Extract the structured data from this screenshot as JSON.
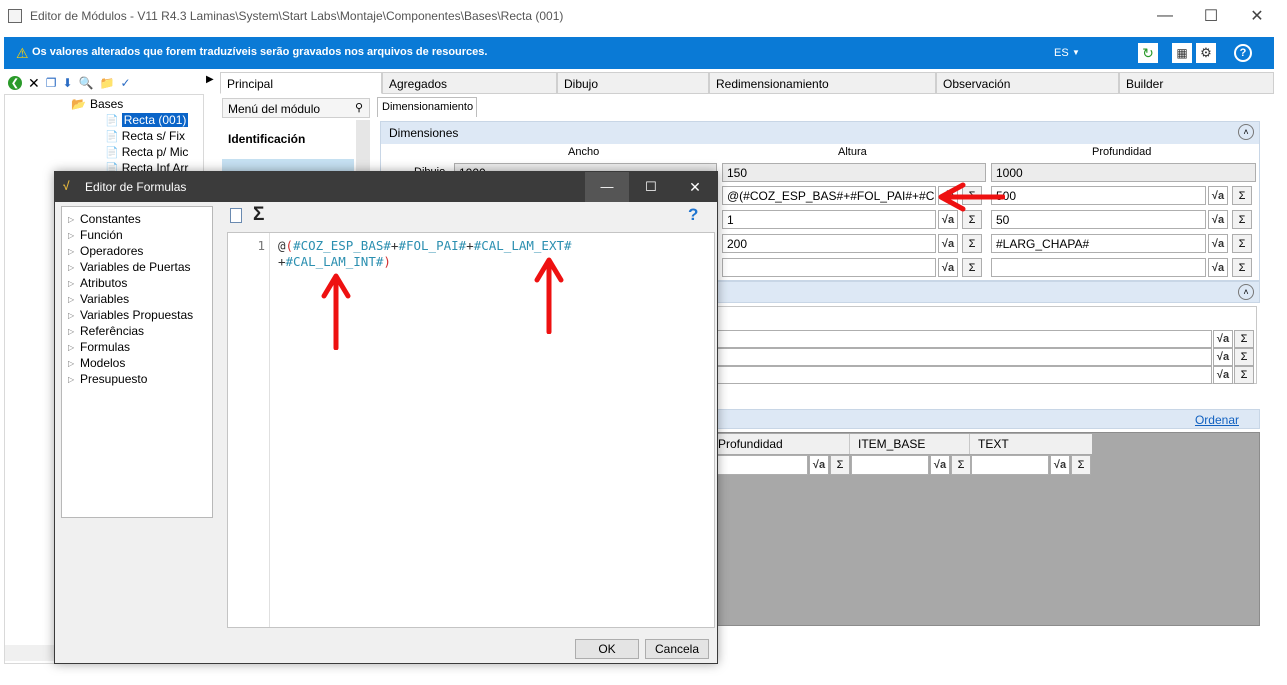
{
  "window": {
    "title": "Editor de Módulos - V11 R4.3 Laminas\\System\\Start Labs\\Montaje\\Componentes\\Bases\\Recta (001)"
  },
  "banner": {
    "message": "Os valores alterados que forem traduzíveis serão gravados nos arquivos de resources.",
    "lang": "ES",
    "color": "#0a7ad6"
  },
  "tree": {
    "folder": "Bases",
    "items": [
      "Recta (001)",
      "Recta s/ Fix",
      "Recta p/ Mic",
      "Recta Inf Arr"
    ]
  },
  "tabs": [
    "Principal",
    "Agregados",
    "Dibujo",
    "Redimensionamiento",
    "Observación",
    "Builder"
  ],
  "menu": {
    "header": "Menú del módulo",
    "item1": "Identificación",
    "item2": "Dimensionamiento"
  },
  "subtab": "Dimensionamiento",
  "dimensiones": {
    "header": "Dimensiones",
    "cols": [
      "Ancho",
      "Altura",
      "Profundidad"
    ],
    "row_label": "Dibujo",
    "rows": [
      [
        "1000",
        "150",
        "1000"
      ],
      [
        "",
        "@(#COZ_ESP_BAS#+#FOL_PAI#+#C",
        "500"
      ],
      [
        "",
        "1",
        "50"
      ],
      [
        "",
        "200",
        "#LARG_CHAPA#"
      ],
      [
        "",
        "",
        ""
      ]
    ]
  },
  "lower": {
    "ordenar": "Ordenar",
    "cols": [
      "Profundidad",
      "ITEM_BASE",
      "TEXT"
    ]
  },
  "formula_dialog": {
    "title": "Editor de Formulas",
    "categories": [
      "Constantes",
      "Función",
      "Operadores",
      "Variables de Puertas",
      "Atributos",
      "Variables",
      "Variables Propuestas",
      "Referências",
      "Formulas",
      "Modelos",
      "Presupuesto"
    ],
    "line_no": "1",
    "line1": {
      "at": "@",
      "open": "(",
      "a": "#COZ_ESP_BAS#",
      "p1": "+",
      "b": "#FOL_PAI#",
      "p2": "+",
      "c": "#CAL_LAM_EXT#"
    },
    "line2": {
      "p3": "+",
      "d": "#CAL_LAM_INT#",
      "close": ")"
    },
    "ok": "OK",
    "cancel": "Cancela",
    "help": "?"
  },
  "symbols": {
    "sigma": "Σ",
    "sqrt": "√a"
  }
}
